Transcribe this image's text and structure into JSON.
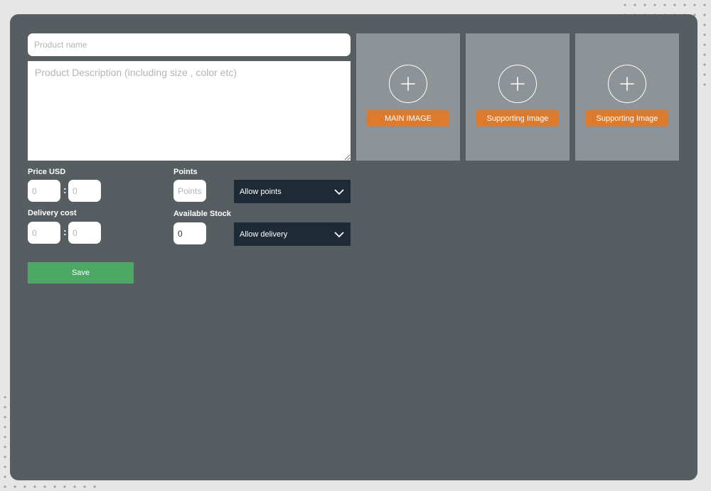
{
  "form": {
    "product_name_placeholder": "Product name",
    "description_placeholder": "Product Description (including size , color etc)",
    "price_label": "Price USD",
    "price_major_placeholder": "0",
    "price_minor_placeholder": "0",
    "delivery_label": "Delivery cost",
    "delivery_major_placeholder": "0",
    "delivery_minor_placeholder": "0",
    "separator": ":",
    "points_label": "Points",
    "points_placeholder": "Points",
    "stock_label": "Available Stock",
    "stock_value": "0",
    "allow_points_option": "Allow points",
    "allow_delivery_option": "Allow delivery",
    "save_label": "Save"
  },
  "images": [
    {
      "button_label": "MAIN IMAGE",
      "icon": "plus-circle-icon"
    },
    {
      "button_label": "Supporting Image",
      "icon": "plus-circle-icon"
    },
    {
      "button_label": "Supporting Image",
      "icon": "plus-circle-icon"
    }
  ],
  "colors": {
    "panel": "#575e61",
    "image_card": "#8d9396",
    "image_button": "#dd7a2c",
    "select_bg": "#1e2a36",
    "save_button": "#4ca865"
  }
}
